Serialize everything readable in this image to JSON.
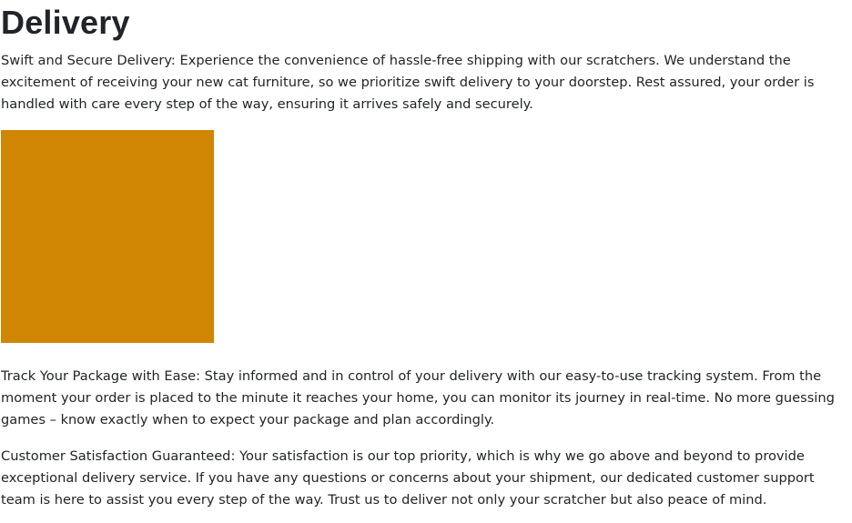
{
  "page": {
    "title": "Delivery",
    "paragraphs": [
      "Swift and Secure Delivery: Experience the convenience of hassle-free shipping with our scratchers. We understand the excitement of receiving your new cat furniture, so we prioritize swift delivery to your doorstep. Rest assured, your order is handled with care every step of the way, ensuring it arrives safely and securely.",
      "Track Your Package with Ease: Stay informed and in control of your delivery with our easy-to-use tracking system. From the moment your order is placed to the minute it reaches your home, you can monitor its journey in real-time. No more guessing games – know exactly when to expect your package and plan accordingly.",
      "Customer Satisfaction Guaranteed: Your satisfaction is our top priority, which is why we go above and beyond to provide exceptional delivery service. If you have any questions or concerns about your shipment, our dedicated customer support team is here to assist you every step of the way. Trust us to deliver not only your scratcher but also peace of mind."
    ],
    "image_color": "#d08602"
  }
}
